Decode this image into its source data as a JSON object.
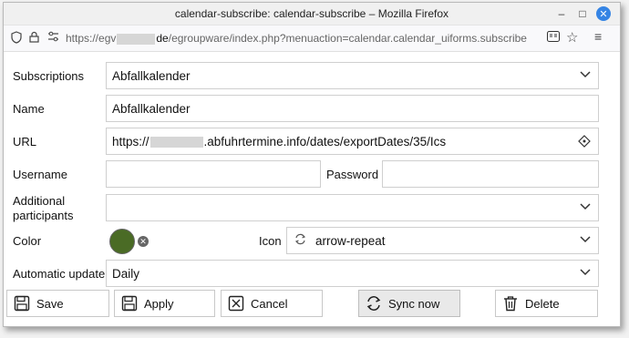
{
  "window": {
    "title": "calendar-subscribe: calendar-subscribe – Mozilla Firefox",
    "url_start": "https://egv",
    "url_domain_end": "de",
    "url_rest": "/egroupware/index.php?menuaction=calendar.calendar_uiforms.subscribe"
  },
  "form": {
    "subscriptions": {
      "label": "Subscriptions",
      "value": "Abfallkalender"
    },
    "name": {
      "label": "Name",
      "value": "Abfallkalender"
    },
    "url": {
      "label": "URL",
      "value_start": "https://",
      "value_end": ".abfuhrtermine.info/dates/exportDates/35/Ics"
    },
    "username": {
      "label": "Username",
      "value": ""
    },
    "password": {
      "label": "Password",
      "value": ""
    },
    "participants": {
      "label1": "Additional",
      "label2": "participants",
      "value": ""
    },
    "color": {
      "label": "Color",
      "value": "#4a6b25"
    },
    "icon": {
      "label": "Icon",
      "value": "arrow-repeat"
    },
    "update": {
      "label": "Automatic update",
      "value": "Daily"
    }
  },
  "buttons": {
    "save": "Save",
    "apply": "Apply",
    "cancel": "Cancel",
    "sync": "Sync now",
    "delete": "Delete"
  }
}
